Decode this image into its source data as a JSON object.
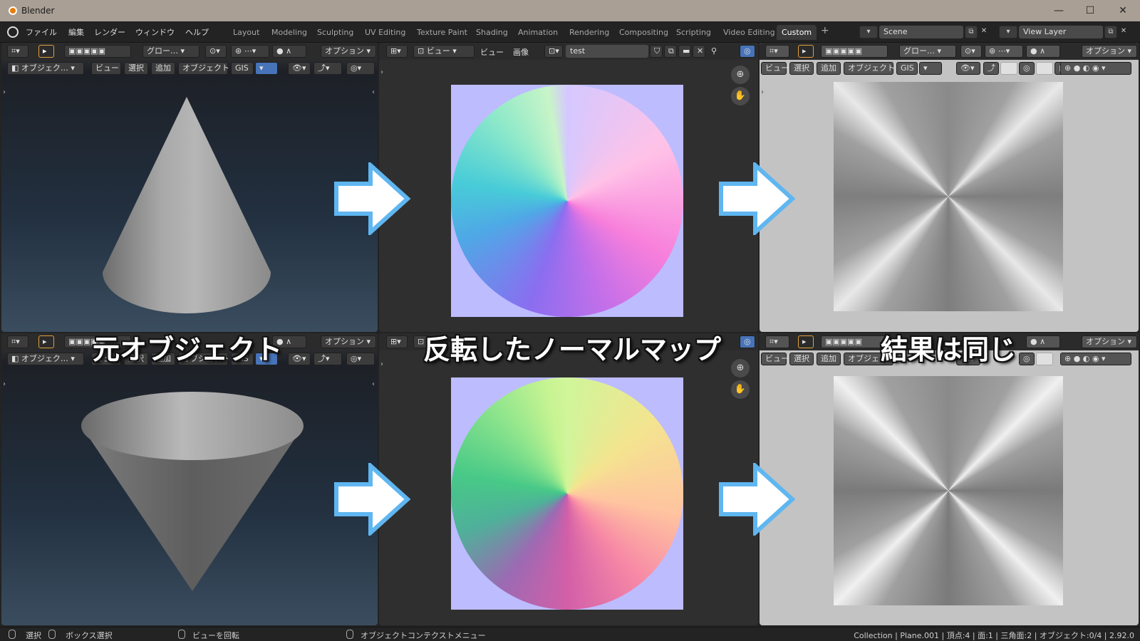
{
  "window": {
    "title": "Blender",
    "minimize": "—",
    "maximize": "☐",
    "close": "✕"
  },
  "menu": [
    "ファイル",
    "編集",
    "レンダー",
    "ウィンドウ",
    "ヘルプ"
  ],
  "workspaces": [
    "Layout",
    "Modeling",
    "Sculpting",
    "UV Editing",
    "Texture Paint",
    "Shading",
    "Animation",
    "Rendering",
    "Compositing",
    "Scripting",
    "Video Editing",
    "Custom"
  ],
  "active_workspace": "Custom",
  "scene_field": "Scene",
  "viewlayer_field": "View Layer",
  "viewport_header": {
    "transform": "グロー…",
    "options": "オプション",
    "mode": "オブジェク…",
    "view": "ビュー",
    "select": "選択",
    "add": "追加",
    "object": "オブジェクト",
    "gis": "GIS"
  },
  "image_editor_header": {
    "view_dropdown": "ビュー",
    "view": "ビュー",
    "image": "画像",
    "image_name": "test"
  },
  "captions": {
    "original": "元オブジェクト",
    "inverted": "反転したノーマルマップ",
    "same_result": "結果は同じ"
  },
  "statusbar": {
    "select": "選択",
    "box_select": "ボックス選択",
    "rotate_view": "ビューを回転",
    "context_menu": "オブジェクトコンテクストメニュー",
    "stats": "Collection | Plane.001 | 頂点:4 | 面:1 | 三角面:2 | オブジェクト:0/4 | 2.92.0"
  },
  "colors": {
    "accent": "#4773b8",
    "arrow_fill": "#ffffff",
    "arrow_stroke": "#5fb6f0",
    "normal_bg": "#bdbcff"
  }
}
